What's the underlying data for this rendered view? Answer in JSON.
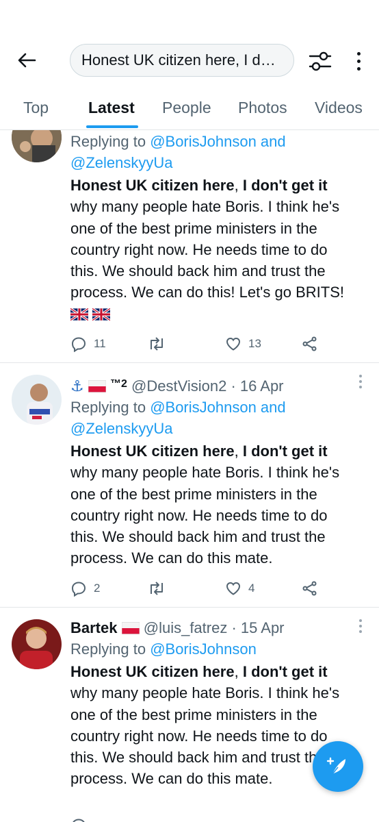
{
  "search": {
    "query": "Honest UK citizen here, I don't get it"
  },
  "tabs": [
    {
      "label": "Top"
    },
    {
      "label": "Latest"
    },
    {
      "label": "People"
    },
    {
      "label": "Photos"
    },
    {
      "label": "Videos"
    }
  ],
  "colors": {
    "accent": "#1d9bf0",
    "text": "#0f1419",
    "muted": "#536471"
  },
  "tweets": [
    {
      "reply_prefix": "Replying to ",
      "reply_to": [
        "@BorisJohnson and",
        "@ZelenskyyUa"
      ],
      "text_bold": "Honest UK citizen here",
      "text_comma": ", ",
      "text_bold2": "I don't get it",
      "lines": [
        "why many people hate Boris. I think he's",
        "one of the best prime ministers in the",
        "country right now. He needs time to do",
        "this. We should back him and trust the",
        "process. We can do this! Let's go BRITS!"
      ],
      "emoji": "uk-flag uk-flag",
      "replies": "11",
      "likes": "13"
    },
    {
      "name": "⚓🇵🇱™2",
      "handle": "@DestVision2",
      "date": "· 16 Apr",
      "reply_prefix": "Replying to ",
      "reply_to": [
        "@BorisJohnson and",
        "@ZelenskyyUa"
      ],
      "text_bold": "Honest UK citizen here",
      "text_comma": ", ",
      "text_bold2": "I don't get it",
      "lines": [
        "why many people hate Boris. I think he's",
        "one of the best prime ministers in the",
        "country right now. He needs time to do",
        "this. We should back him and trust the",
        "process. We can do this mate."
      ],
      "replies": "2",
      "likes": "4"
    },
    {
      "name": "Bartek",
      "handle": "@luis_fatrez",
      "date": "· 15 Apr",
      "reply_prefix": "Replying to ",
      "reply_to": [
        "@BorisJohnson"
      ],
      "text_bold": "Honest UK citizen here",
      "text_comma": ", ",
      "text_bold2": "I don't get it",
      "lines": [
        "why many people hate Boris. I think he's",
        "one of the best prime ministers in the",
        "country right now. He needs time to do",
        "this. We should back him and trust the",
        "process. We can do this mate."
      ]
    }
  ],
  "tweet2_name_parts": {
    "anchor": "⚓",
    "tm": "™2"
  }
}
